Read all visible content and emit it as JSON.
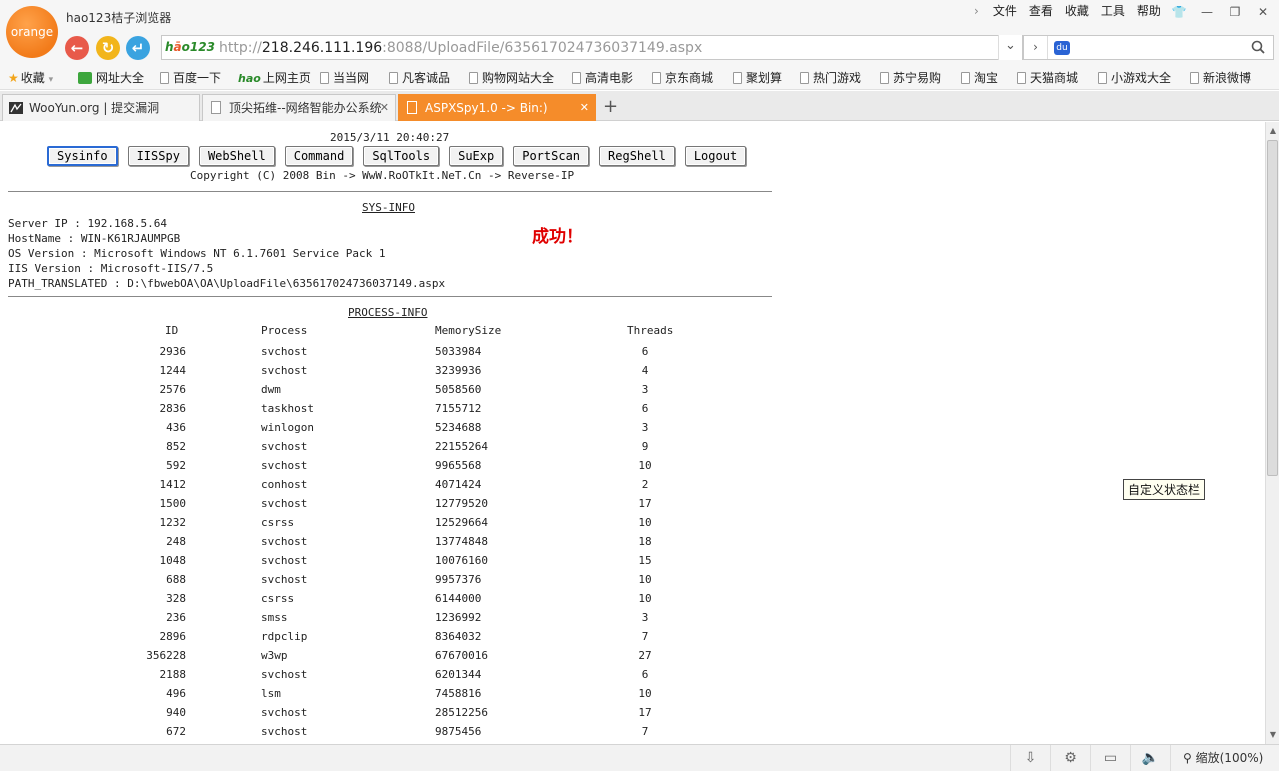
{
  "browser": {
    "logo_text": "orange",
    "app_title": "hao123桔子浏览器",
    "menu": [
      "文件",
      "查看",
      "收藏",
      "工具",
      "帮助"
    ],
    "url_prefix": "http://",
    "url_host": "218.246.111.196",
    "url_rest": ":8088/UploadFile/635617024736037149.aspx",
    "search_value": ""
  },
  "bookmarks": [
    {
      "label": "收藏",
      "icon": "star-icon"
    },
    {
      "label": "网址大全",
      "icon": "green-icon"
    },
    {
      "label": "百度一下",
      "icon": "doc-icon"
    },
    {
      "label": "上网主页",
      "icon": "hao-icon"
    },
    {
      "label": "当当网",
      "icon": "doc-icon"
    },
    {
      "label": "凡客诚品",
      "icon": "doc-icon"
    },
    {
      "label": "购物网站大全",
      "icon": "doc-icon"
    },
    {
      "label": "高清电影",
      "icon": "doc-icon"
    },
    {
      "label": "京东商城",
      "icon": "doc-icon"
    },
    {
      "label": "聚划算",
      "icon": "doc-icon"
    },
    {
      "label": "热门游戏",
      "icon": "doc-icon"
    },
    {
      "label": "苏宁易购",
      "icon": "doc-icon"
    },
    {
      "label": "淘宝",
      "icon": "doc-icon"
    },
    {
      "label": "天猫商城",
      "icon": "doc-icon"
    },
    {
      "label": "小游戏大全",
      "icon": "doc-icon"
    },
    {
      "label": "新浪微博",
      "icon": "doc-icon"
    }
  ],
  "tabs": [
    {
      "label": "WooYun.org | 提交漏洞",
      "active": false
    },
    {
      "label": "顶尖拓维--网络智能办公系统",
      "active": false
    },
    {
      "label": "ASPXSpy1.0 -> Bin:)",
      "active": true
    }
  ],
  "page": {
    "timestamp": "2015/3/11 20:40:27",
    "buttons": [
      "Sysinfo",
      "IISSpy",
      "WebShell",
      "Command",
      "SqlTools",
      "SuExp",
      "PortScan",
      "RegShell",
      "Logout"
    ],
    "copyright": "Copyright (C) 2008 Bin -> WwW.RoOTkIt.NeT.Cn -> Reverse-IP",
    "sys_title": "SYS-INFO",
    "sys_lines": [
      "Server IP : 192.168.5.64",
      "HostName : WIN-K61RJAUMPGB",
      "OS Version : Microsoft Windows NT 6.1.7601 Service Pack 1",
      "IIS Version : Microsoft-IIS/7.5",
      "PATH_TRANSLATED : D:\\fbwebOA\\OA\\UploadFile\\635617024736037149.aspx"
    ],
    "success_text": "成功！",
    "proc_title": "PROCESS-INFO",
    "proc_headers": [
      "ID",
      "Process",
      "MemorySize",
      "Threads"
    ],
    "processes": [
      [
        "2936",
        "svchost",
        "5033984",
        "6"
      ],
      [
        "1244",
        "svchost",
        "3239936",
        "4"
      ],
      [
        "2576",
        "dwm",
        "5058560",
        "3"
      ],
      [
        "2836",
        "taskhost",
        "7155712",
        "6"
      ],
      [
        "436",
        "winlogon",
        "5234688",
        "3"
      ],
      [
        "852",
        "svchost",
        "22155264",
        "9"
      ],
      [
        "592",
        "svchost",
        "9965568",
        "10"
      ],
      [
        "1412",
        "conhost",
        "4071424",
        "2"
      ],
      [
        "1500",
        "svchost",
        "12779520",
        "17"
      ],
      [
        "1232",
        "csrss",
        "12529664",
        "10"
      ],
      [
        "248",
        "svchost",
        "13774848",
        "18"
      ],
      [
        "1048",
        "svchost",
        "10076160",
        "15"
      ],
      [
        "688",
        "svchost",
        "9957376",
        "10"
      ],
      [
        "328",
        "csrss",
        "6144000",
        "10"
      ],
      [
        "236",
        "smss",
        "1236992",
        "3"
      ],
      [
        "2896",
        "rdpclip",
        "8364032",
        "7"
      ],
      [
        "356228",
        "w3wp",
        "67670016",
        "27"
      ],
      [
        "2188",
        "svchost",
        "6201344",
        "6"
      ],
      [
        "496",
        "lsm",
        "7458816",
        "10"
      ],
      [
        "940",
        "svchost",
        "28512256",
        "17"
      ],
      [
        "672",
        "svchost",
        "9875456",
        "7"
      ]
    ]
  },
  "tooltip": "自定义状态栏",
  "status": {
    "zoom_label": "缩放(100%)"
  }
}
